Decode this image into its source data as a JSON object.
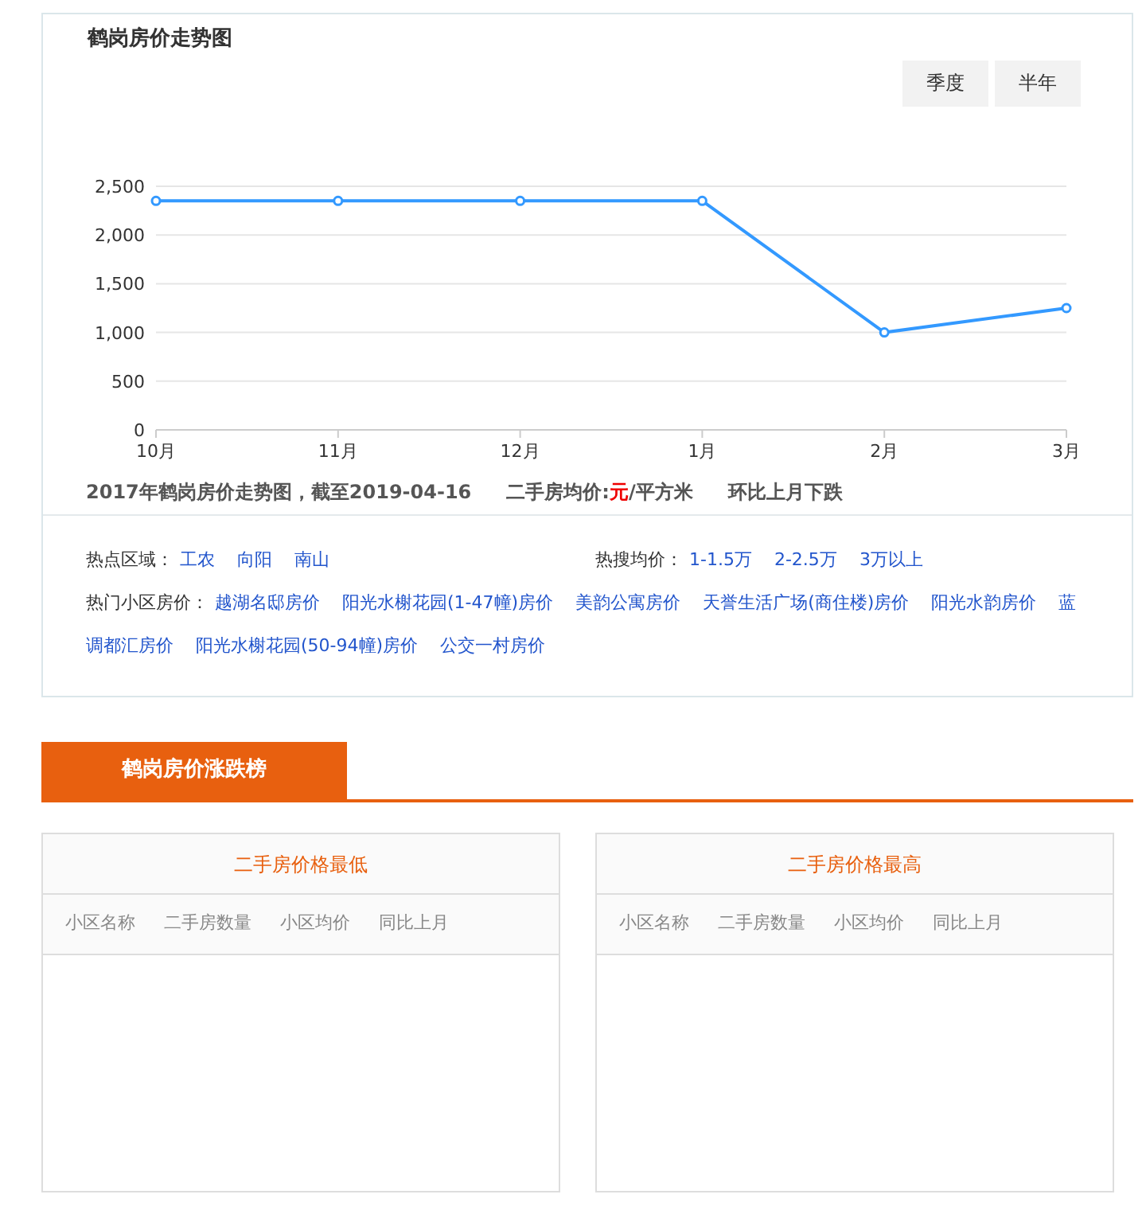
{
  "trend": {
    "title": "鹤岗房价走势图",
    "period_buttons": [
      {
        "label": "季度",
        "selected": false
      },
      {
        "label": "半年",
        "selected": false
      }
    ],
    "chart_data": {
      "type": "line",
      "categories": [
        "10月",
        "11月",
        "12月",
        "1月",
        "2月",
        "3月"
      ],
      "ylim": [
        0,
        2500
      ],
      "yticks": [
        {
          "value": 0,
          "label": "0"
        },
        {
          "value": 500,
          "label": "500"
        },
        {
          "value": 1000,
          "label": "1,000"
        },
        {
          "value": 1500,
          "label": "1,500"
        },
        {
          "value": 2000,
          "label": "2,000"
        },
        {
          "value": 2500,
          "label": "2,500"
        }
      ],
      "grid": true,
      "series": [
        {
          "color": "#3399ff",
          "marker": true,
          "values": [
            2350,
            2350,
            2350,
            2350,
            1000,
            1250
          ]
        }
      ]
    },
    "summary": [
      "2017年鹤岗房价走势图，截至2019-04-16",
      "二手房均价:**元**/平方米",
      "环比上月下跌"
    ],
    "hot_areas": {
      "label": "热点区域：",
      "links": [
        "工农",
        "向阳",
        "南山"
      ]
    },
    "hot_prices": {
      "label": "热搜均价：",
      "links": [
        "1-1.5万",
        "2-2.5万",
        "3万以上"
      ]
    },
    "hot_communities": {
      "label": "热门小区房价：",
      "lines": [
        [
          "越湖名邸房价",
          "阳光水榭花园(1-47幢)房价",
          "美韵公寓房价",
          "天誉生活广场(商住楼)房价",
          "阳光水韵房价",
          "蓝"
        ],
        [
          "调都汇房价",
          "阳光水榭花园(50-94幢)房价",
          "公交一村房价"
        ]
      ]
    }
  },
  "ranking": {
    "tab": "鹤岗房价涨跌榜",
    "tables": [
      {
        "title": "二手房价格最低",
        "columns": [
          "小区名称",
          "二手房数量",
          "小区均价",
          "同比上月"
        ]
      },
      {
        "title": "二手房价格最高",
        "columns": [
          "小区名称",
          "二手房数量",
          "小区均价",
          "同比上月"
        ]
      }
    ]
  }
}
